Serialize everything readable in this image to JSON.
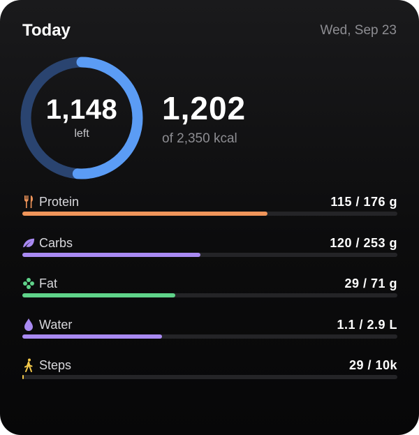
{
  "header": {
    "title": "Today",
    "date": "Wed, Sep 23"
  },
  "calories": {
    "left_value": "1,148",
    "left_label": "left",
    "consumed_value": "1,202",
    "goal_text": "of 2,350 kcal",
    "consumed_fraction": 0.511,
    "ring_color": "#5b9cf5",
    "ring_track_color": "#2a4470"
  },
  "metrics": [
    {
      "name": "protein",
      "label": "Protein",
      "value": "115 / 176 g",
      "fraction": 0.653,
      "color": "#f0955a",
      "icon": "fork-knife-icon"
    },
    {
      "name": "carbs",
      "label": "Carbs",
      "value": "120 / 253 g",
      "fraction": 0.474,
      "color": "#a98af2",
      "icon": "leaf-icon"
    },
    {
      "name": "fat",
      "label": "Fat",
      "value": "29 / 71 g",
      "fraction": 0.408,
      "color": "#5fd38a",
      "icon": "flower-icon"
    },
    {
      "name": "water",
      "label": "Water",
      "value": "1.1 / 2.9 L",
      "fraction": 0.372,
      "color": "#a98af2",
      "icon": "water-drop-icon"
    },
    {
      "name": "steps",
      "label": "Steps",
      "value": "29 / 10k",
      "fraction": 0.003,
      "color": "#f2c84a",
      "icon": "walking-icon"
    }
  ]
}
